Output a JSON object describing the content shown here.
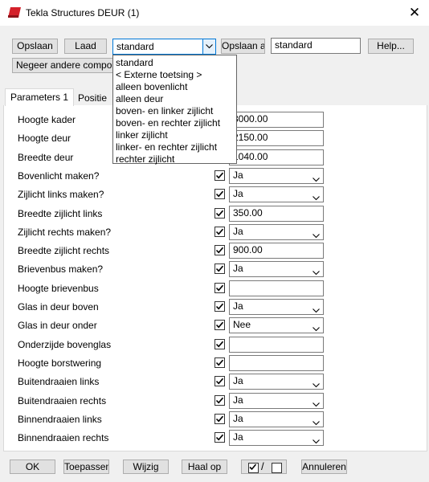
{
  "window": {
    "title": "Tekla Structures  DEUR (1)"
  },
  "toolbar": {
    "save_label": "Opslaan",
    "load_label": "Laad",
    "preset_value": "standard",
    "save_as_label": "Opslaan al",
    "save_as_value": "standard",
    "help_label": "Help...",
    "ignore_label": "Negeer andere compon"
  },
  "dropdown_items": [
    "standard",
    "< Externe toetsing >",
    "alleen bovenlicht",
    "alleen deur",
    "boven- en linker zijlicht",
    "boven- en rechter zijlicht",
    "linker zijlicht",
    "linker- en rechter zijlicht",
    "rechter zijlicht"
  ],
  "tabs": [
    "Parameters 1",
    "Positie"
  ],
  "rows": [
    {
      "label": "Hoogte kader",
      "value": "3000.00",
      "type": "text",
      "checkbox": false
    },
    {
      "label": "Hoogte deur",
      "value": "2150.00",
      "type": "text",
      "checkbox": false
    },
    {
      "label": "Breedte deur",
      "value": "1040.00",
      "type": "text",
      "checkbox": false
    },
    {
      "label": "Bovenlicht maken?",
      "value": "Ja",
      "type": "select",
      "checkbox": true
    },
    {
      "label": "Zijlicht links maken?",
      "value": "Ja",
      "type": "select",
      "checkbox": true
    },
    {
      "label": "Breedte zijlicht links",
      "value": "350.00",
      "type": "text",
      "checkbox": true
    },
    {
      "label": "Zijlicht rechts maken?",
      "value": "Ja",
      "type": "select",
      "checkbox": true
    },
    {
      "label": "Breedte zijlicht rechts",
      "value": "900.00",
      "type": "text",
      "checkbox": true
    },
    {
      "label": "Brievenbus maken?",
      "value": "Ja",
      "type": "select",
      "checkbox": true
    },
    {
      "label": "Hoogte brievenbus",
      "value": "",
      "type": "text",
      "checkbox": true
    },
    {
      "label": "Glas in deur boven",
      "value": "Ja",
      "type": "select",
      "checkbox": true
    },
    {
      "label": "Glas in deur onder",
      "value": "Nee",
      "type": "select",
      "checkbox": true
    },
    {
      "label": "Onderzijde bovenglas",
      "value": "",
      "type": "text",
      "checkbox": true
    },
    {
      "label": "Hoogte borstwering",
      "value": "",
      "type": "text",
      "checkbox": true
    },
    {
      "label": "Buitendraaien links",
      "value": "Ja",
      "type": "select",
      "checkbox": true
    },
    {
      "label": "Buitendraaien rechts",
      "value": "Ja",
      "type": "select",
      "checkbox": true
    },
    {
      "label": "Binnendraaien links",
      "value": "Ja",
      "type": "select",
      "checkbox": true
    },
    {
      "label": "Binnendraaien rechts",
      "value": "Ja",
      "type": "select",
      "checkbox": true
    }
  ],
  "footer": {
    "ok_label": "OK",
    "apply_label": "Toepassen",
    "modify_label": "Wijzig",
    "get_label": "Haal op",
    "toggle_separator": "/",
    "cancel_label": "Annuleren"
  },
  "colors": {
    "app_icon": "#d4202a",
    "window_bg": "#f0f0f0"
  }
}
